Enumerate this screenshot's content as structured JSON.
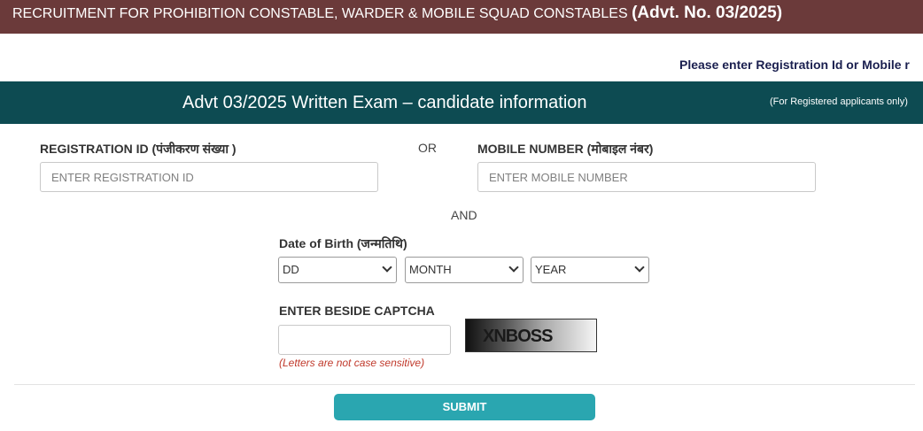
{
  "banner": {
    "title": "RECRUITMENT FOR PROHIBITION CONSTABLE, WARDER & MOBILE SQUAD CONSTABLES",
    "advt": "(Advt. No. 03/2025)"
  },
  "notice": "Please enter Registration Id or Mobile r",
  "info_bar": {
    "title": "Advt 03/2025 Written Exam – candidate information",
    "note": "(For Registered applicants only)"
  },
  "registration": {
    "label": "REGISTRATION ID (पंजीकरण संख्या )",
    "placeholder": "ENTER REGISTRATION ID"
  },
  "or_text": "OR",
  "mobile": {
    "label": "MOBILE NUMBER (मोबाइल नंबर)",
    "placeholder": "ENTER MOBILE NUMBER"
  },
  "and_text": "AND",
  "dob": {
    "label": "Date of Birth (जन्मतिथि)",
    "day": "DD",
    "month": "MONTH",
    "year": "YEAR"
  },
  "captcha": {
    "label": "ENTER BESIDE CAPTCHA",
    "value": "",
    "image_text": "XNBOSS",
    "hint": "(Letters are not case sensitive)"
  },
  "submit_label": "SUBMIT"
}
